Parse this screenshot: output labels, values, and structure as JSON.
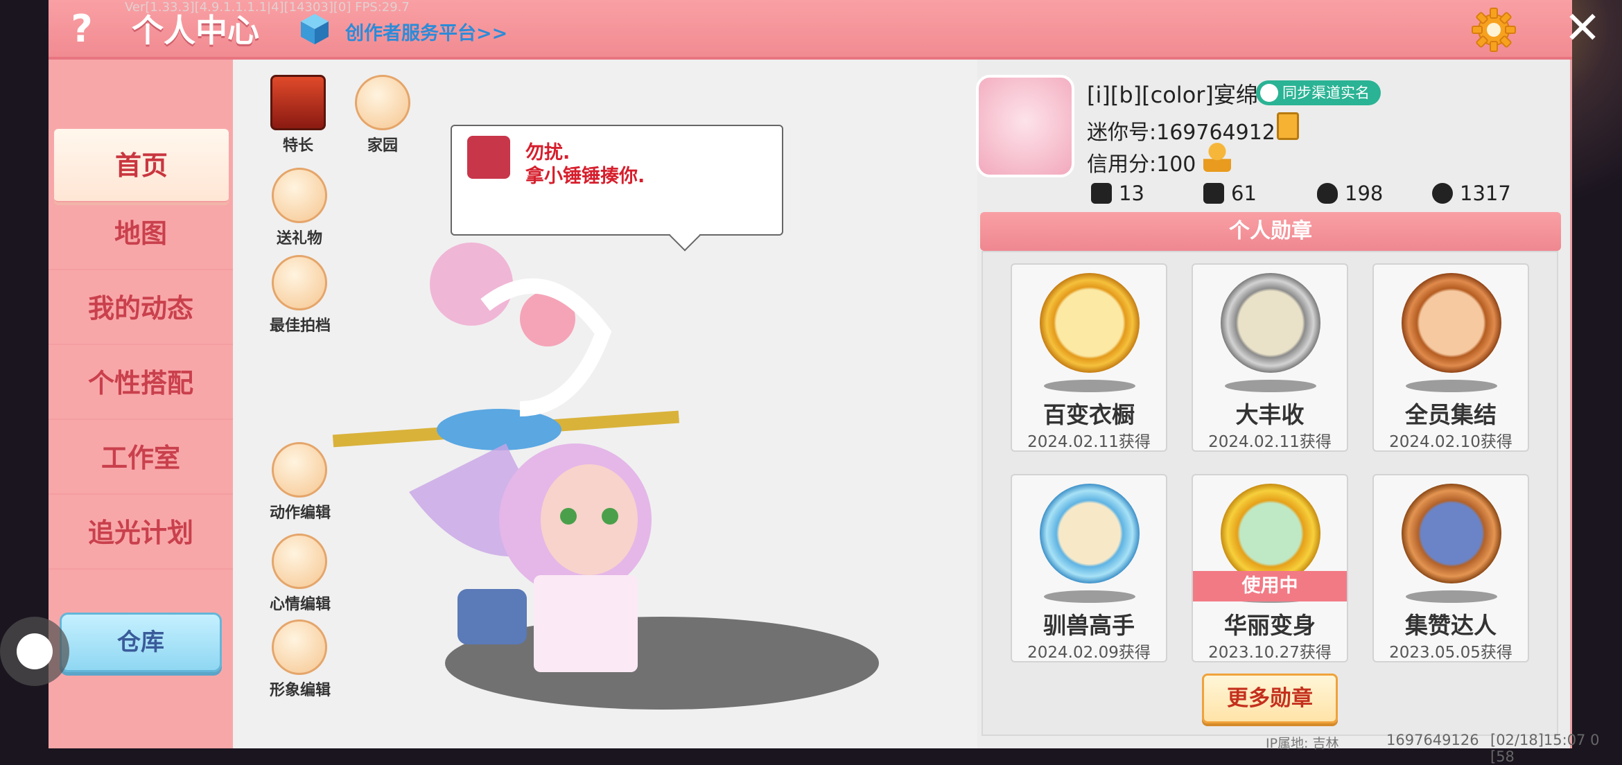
{
  "debug_text": "Ver[1.33.3][4.9.1.1.1.1|4][14303][0] FPS:29.7",
  "header": {
    "title": "个人中心",
    "creator_link": "创作者服务平台>>",
    "help_icon": "?",
    "close_icon": "✕"
  },
  "nav": {
    "items": [
      {
        "label": "首页"
      },
      {
        "label": "地图"
      },
      {
        "label": "我的动态"
      },
      {
        "label": "个性搭配"
      },
      {
        "label": "工作室"
      },
      {
        "label": "追光计划"
      }
    ],
    "depot": "仓库"
  },
  "side_icons": {
    "speciality": "特长",
    "home": "家园",
    "gift": "送礼物",
    "best_photo": "最佳拍档",
    "action_edit": "动作编辑",
    "mood_edit": "心情编辑",
    "image_edit": "形象编辑"
  },
  "speech": {
    "line1": "勿扰.",
    "line2": "拿小锤锤揍你."
  },
  "profile": {
    "name": "[i][b][color]宴绵.",
    "sync_badge": "同步渠道实名",
    "mini_id": "迷你号:1697649126",
    "credit": "信用分:100",
    "stats": [
      "13",
      "61",
      "198",
      "1317"
    ]
  },
  "medals": {
    "header": "个人勋章",
    "items": [
      {
        "name": "百变衣橱",
        "date": "2024.02.11获得",
        "style": "gold"
      },
      {
        "name": "大丰收",
        "date": "2024.02.11获得",
        "style": "silver"
      },
      {
        "name": "全员集结",
        "date": "2024.02.10获得",
        "style": "bronze"
      },
      {
        "name": "驯兽高手",
        "date": "2024.02.09获得",
        "style": "blue"
      },
      {
        "name": "华丽变身",
        "date": "2023.10.27获得",
        "style": "gold2",
        "badge": "使用中"
      },
      {
        "name": "集赞达人",
        "date": "2023.05.05获得",
        "style": "bronze2"
      }
    ],
    "more": "更多勋章"
  },
  "footer": {
    "ip": "IP属地: 吉林",
    "id": "1697649126",
    "time": "[02/18]15:07 0 [58"
  },
  "colors": {
    "header_pink": "#f18b92",
    "nav_pink": "#f8a7a9",
    "nav_text": "#c9404c",
    "creator_blue": "#2c8bd8",
    "sync_green": "#2ab394"
  }
}
